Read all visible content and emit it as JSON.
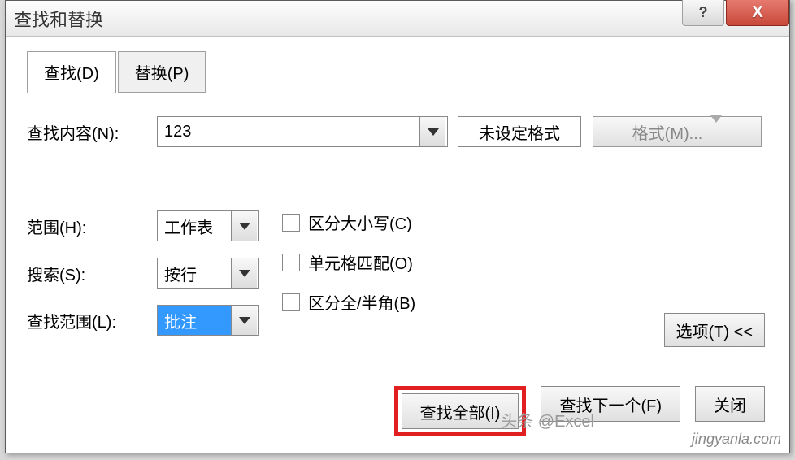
{
  "titlebar": {
    "title": "查找和替换",
    "help": "?",
    "close": "X"
  },
  "tabs": {
    "find": "查找(D)",
    "replace": "替换(P)"
  },
  "findContent": {
    "label": "查找内容(N):",
    "value": "123",
    "formatDisplay": "未设定格式",
    "formatButton": "格式(M)..."
  },
  "scope": {
    "label": "范围(H):",
    "value": "工作表"
  },
  "searchDir": {
    "label": "搜索(S):",
    "value": "按行"
  },
  "lookIn": {
    "label": "查找范围(L):",
    "value": "批注"
  },
  "checkboxes": {
    "matchCase": "区分大小写(C)",
    "wholeCell": "单元格匹配(O)",
    "matchWidth": "区分全/半角(B)"
  },
  "optionsButton": "选项(T) <<",
  "buttons": {
    "findAll": "查找全部(I)",
    "findNext": "查找下一个(F)",
    "close": "关闭"
  },
  "watermark": "jingyanla.com",
  "watermark2": "头条 @Excel"
}
